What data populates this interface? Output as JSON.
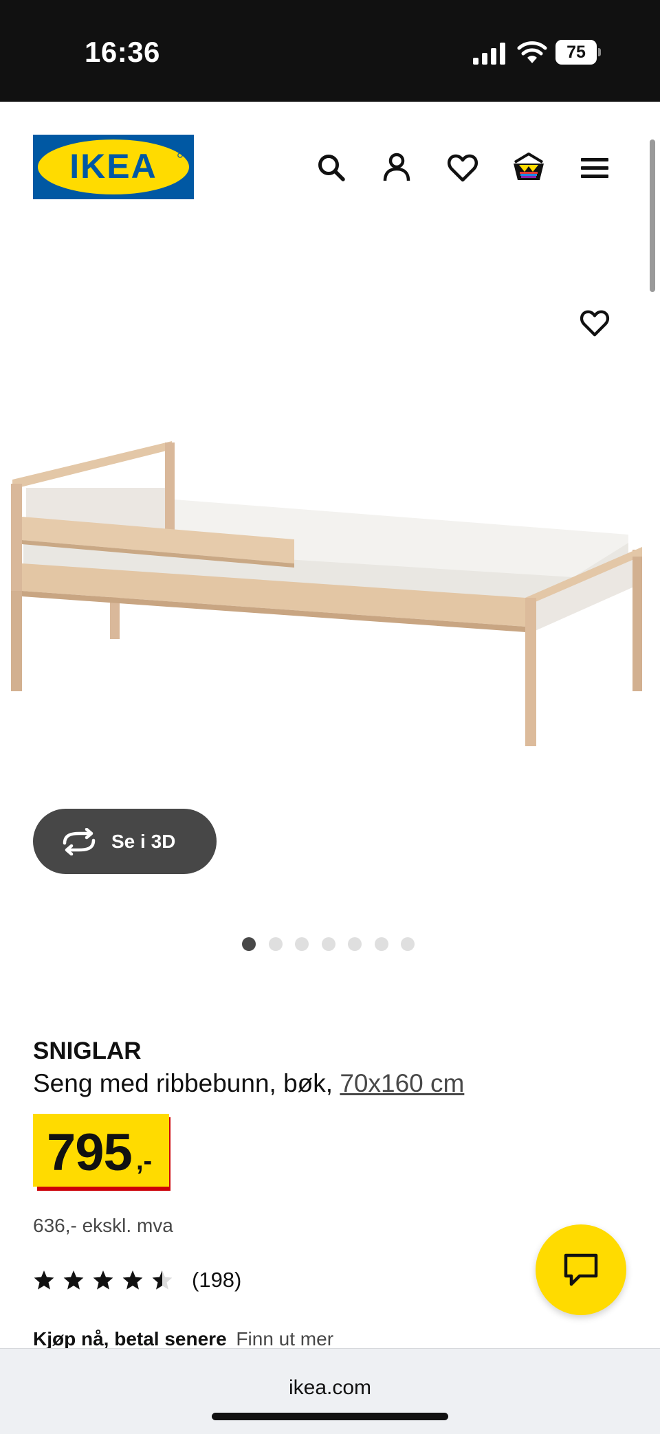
{
  "status_bar": {
    "time": "16:36",
    "battery": "75"
  },
  "header": {
    "logo_text": "IKEA",
    "icons": [
      "search-icon",
      "account-icon",
      "heart-icon",
      "basket-icon",
      "menu-icon"
    ]
  },
  "gallery": {
    "view_3d_label": "Se i 3D",
    "slide_count": 7,
    "active_slide": 1
  },
  "product": {
    "name": "SNIGLAR",
    "description": "Seng med ribbebunn, bøk,",
    "size": "70x160 cm",
    "price_integer": "795",
    "price_suffix": ",-",
    "price_excl_vat": "636,- ekskl. mva",
    "rating_value": 4.5,
    "rating_max": 5,
    "review_count": "(198)"
  },
  "payment": {
    "label": "Kjøp nå, betal senere",
    "link": "Finn ut mer"
  },
  "browser": {
    "url": "ikea.com"
  },
  "colors": {
    "ikea_blue": "#0058a3",
    "ikea_yellow": "#ffdb00",
    "price_red": "#cc0008",
    "dark_button": "#474747"
  }
}
